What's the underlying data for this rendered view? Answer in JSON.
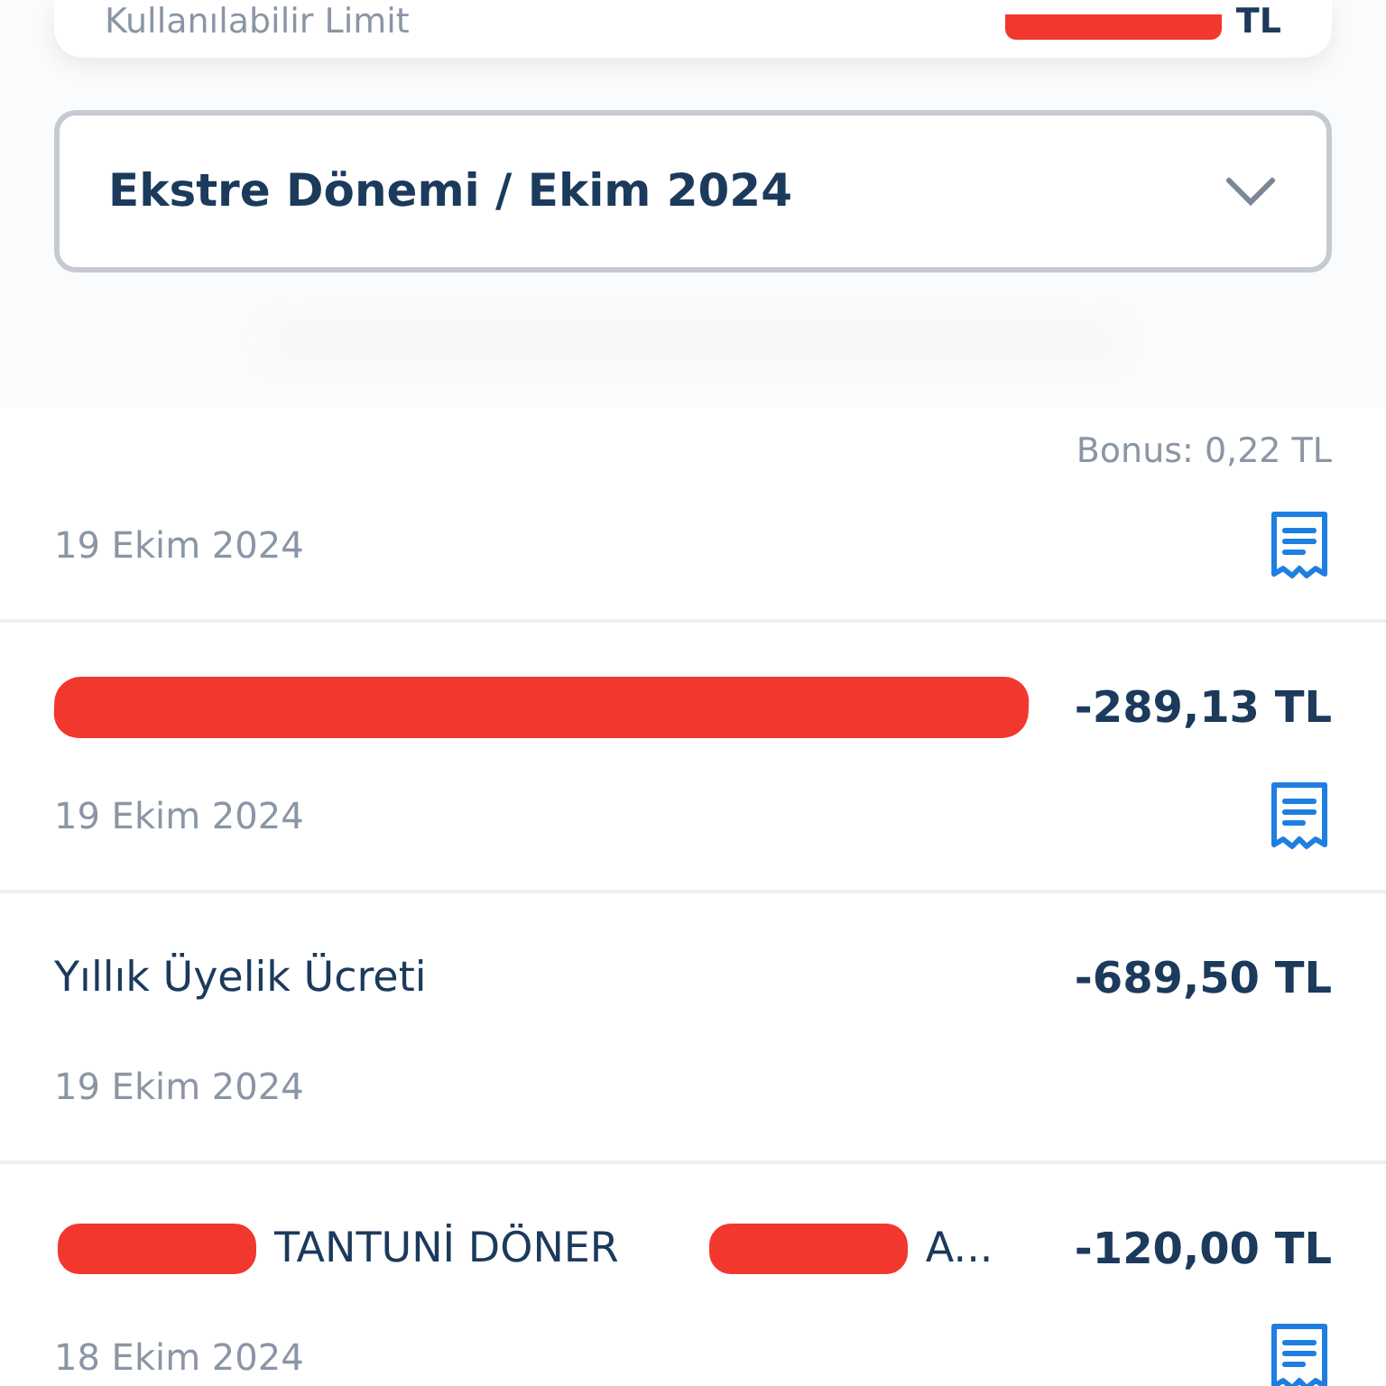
{
  "limit_card": {
    "label": "Kullanılabilir Limit",
    "currency": "TL",
    "amount_redacted": true
  },
  "period_select": {
    "value": "Ekstre Dönemi / Ekim 2024"
  },
  "transactions": [
    {
      "bonus": "Bonus: 0,22 TL",
      "date": "19 Ekim 2024",
      "receipt": true
    },
    {
      "title": [
        {
          "kind": "redaction"
        }
      ],
      "amount": "-289,13 TL",
      "date": "19 Ekim 2024",
      "receipt": true
    },
    {
      "title": [
        {
          "kind": "text",
          "text": "Yıllık Üyelik Ücreti"
        }
      ],
      "amount": "-689,50 TL",
      "date": "19 Ekim 2024",
      "receipt": false
    },
    {
      "title": [
        {
          "kind": "redaction"
        },
        {
          "kind": "text",
          "text": "TANTUNİ DÖNER"
        },
        {
          "kind": "redaction"
        },
        {
          "kind": "text",
          "text": "A..."
        }
      ],
      "amount": "-120,00 TL",
      "date": "18 Ekim 2024",
      "receipt": true
    }
  ]
}
